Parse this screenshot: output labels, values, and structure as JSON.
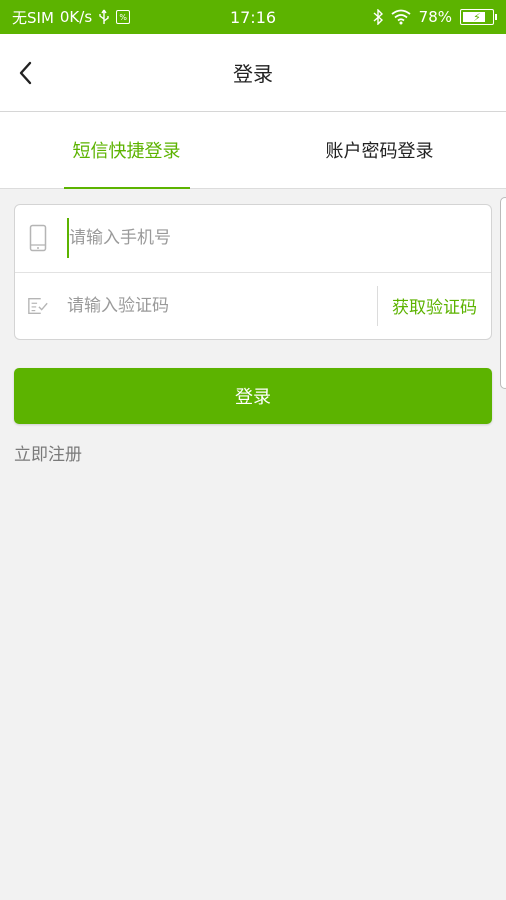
{
  "status_bar": {
    "carrier": "无SIM",
    "net_speed": "0K/s",
    "time": "17:16",
    "battery": "78%",
    "icons": [
      "usb-icon",
      "sim-manager-icon",
      "bluetooth-icon",
      "wifi-icon",
      "battery-icon"
    ]
  },
  "nav": {
    "title": "登录",
    "back_icon": "chevron-left-icon"
  },
  "tabs": [
    {
      "label": "短信快捷登录",
      "active": true
    },
    {
      "label": "账户密码登录",
      "active": false
    }
  ],
  "form": {
    "phone_placeholder": "请输入手机号",
    "code_placeholder": "请输入验证码",
    "get_code_label": "获取验证码"
  },
  "login_label": "登录",
  "register_label": "立即注册",
  "colors": {
    "accent": "#5cb300",
    "background": "#f2f2f2"
  }
}
